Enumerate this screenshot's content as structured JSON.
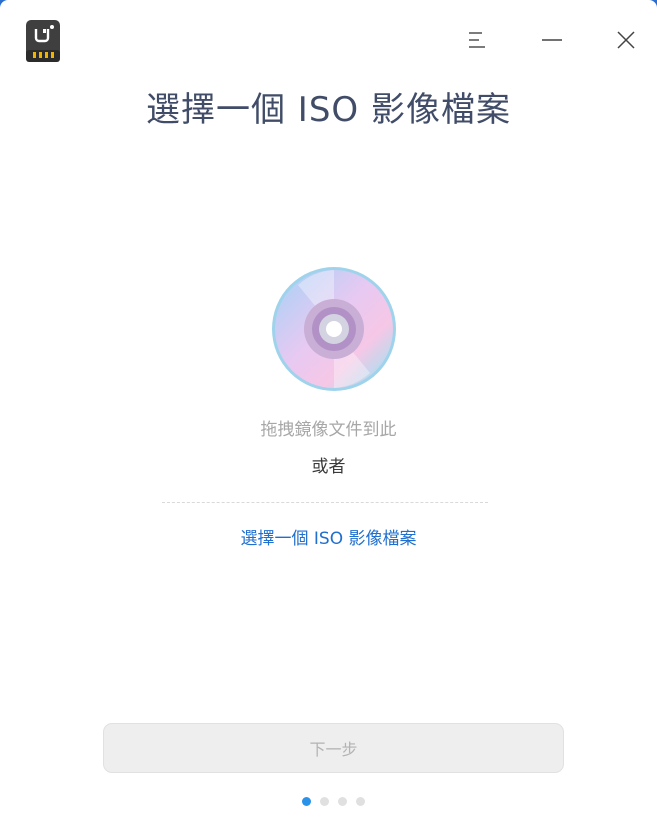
{
  "window": {
    "title": "選擇一個 ISO 影像檔案",
    "icons": {
      "app": "usb-drive-icon",
      "menu": "menu-icon",
      "minimize": "minimize-icon",
      "close": "close-icon"
    }
  },
  "main": {
    "disc_icon": "disc-icon",
    "drop_hint": "拖拽鏡像文件到此",
    "or_text": "或者",
    "select_link": "選擇一個 ISO 影像檔案"
  },
  "footer": {
    "next_label": "下一步",
    "pager": {
      "current_page": 1,
      "total_pages": 4
    }
  },
  "colors": {
    "title": "#414d68",
    "link": "#1f6fcf",
    "active_dot": "#2a92e8",
    "disabled_button_text": "#b3b3b3"
  }
}
